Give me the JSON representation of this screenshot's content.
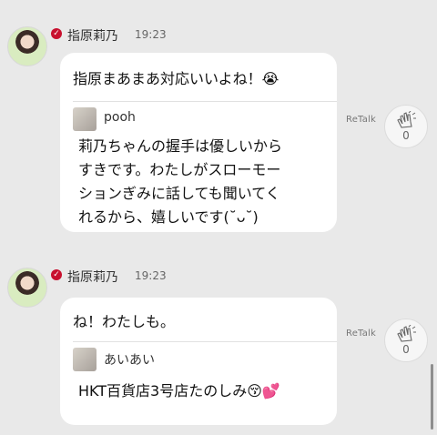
{
  "posts": [
    {
      "author": "指原莉乃",
      "time": "19:23",
      "message": "指原まあまあ対応いいよね！😭",
      "quote": {
        "author": "pooh",
        "text": "莉乃ちゃんの握手は優しいから\nすきです。わたしがスローモー\nションぎみに話しても聞いてく\nれるから、嬉しいです(˘ᴗ˘)"
      },
      "retalk_label": "ReTalk",
      "clap_count": "0"
    },
    {
      "author": "指原莉乃",
      "time": "19:23",
      "message": "ね！わたしも。",
      "quote": {
        "author": "あいあい",
        "text": "HKT百貨店3号店たのしみ😚💕"
      },
      "retalk_label": "ReTalk",
      "clap_count": "0"
    }
  ],
  "icons": {
    "verified": "verified-check-icon",
    "clap": "clapping-hands-icon"
  },
  "colors": {
    "background": "#e9e9e9",
    "bubble": "#ffffff",
    "verified": "#c8102e"
  }
}
